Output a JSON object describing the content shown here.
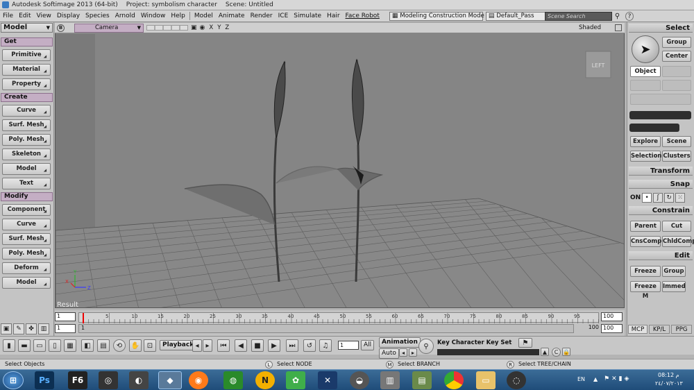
{
  "window": {
    "title_app": "Autodesk Softimage 2013 (64-bit)",
    "title_project": "Project: symbolism character",
    "title_scene": "Scene: Untitled"
  },
  "menus": [
    "File",
    "Edit",
    "View",
    "Display",
    "Species",
    "Arnold",
    "Window",
    "Help",
    "Model",
    "Animate",
    "Render",
    "ICE",
    "Simulate",
    "Hair",
    "Face Robot"
  ],
  "mode_dropdown": "Modeling Construction Mode",
  "pass_dropdown": "Default_Pass",
  "search_placeholder": "Scene Search",
  "left_panel": {
    "top_menu": "Model",
    "sections": [
      {
        "title": "Get",
        "buttons": [
          "Primitive",
          "Material",
          "Property"
        ]
      },
      {
        "title": "Create",
        "buttons": [
          "Curve",
          "Surf. Mesh",
          "Poly. Mesh",
          "Skeleton",
          "Model",
          "Text"
        ]
      },
      {
        "title": "Modify",
        "buttons": [
          "Component",
          "Curve",
          "Surf. Mesh",
          "Poly. Mesh",
          "Deform",
          "Model"
        ]
      }
    ]
  },
  "viewport": {
    "letter": "B",
    "camera": "Camera",
    "axes": [
      "X",
      "Y",
      "Z"
    ],
    "shading": "Shaded",
    "view_cube": "LEFT",
    "result": "Result",
    "gizmo": {
      "x": "X",
      "y": "Y",
      "z": "Z"
    }
  },
  "timeline": {
    "ticks": [
      "5",
      "10",
      "15",
      "20",
      "25",
      "30",
      "35",
      "40",
      "45",
      "50",
      "55",
      "60",
      "65",
      "70",
      "75",
      "80",
      "85",
      "90",
      "95"
    ],
    "start": "1",
    "end": "100",
    "range_start": "1",
    "range_end": "100",
    "range_end2": "100",
    "current": "1"
  },
  "right_panel": {
    "select_title": "Select",
    "group": "Group",
    "center": "Center",
    "object": "Object",
    "explore": "Explore",
    "scene": "Scene",
    "selection": "Selection",
    "clusters": "Clusters",
    "transform": "Transform",
    "snap": "Snap",
    "snap_on": "ON",
    "constrain": "Constrain",
    "parent": "Parent",
    "cut": "Cut",
    "cnscomp": "CnsComp",
    "chldcomp": "ChldComp",
    "edit": "Edit",
    "freeze": "Freeze",
    "group2": "Group",
    "freeze_m": "Freeze M",
    "immed": "Immed",
    "tabs": [
      "MCP",
      "KP/L",
      "PPG"
    ]
  },
  "playback": {
    "playback_label": "Playback",
    "frame": "1",
    "all": "All",
    "animation": "Animation",
    "auto": "Auto",
    "keyset": "Key Character Key Set"
  },
  "status": {
    "left": "Select Objects",
    "l_label": "L",
    "l_text": "Select NODE",
    "m_label": "M",
    "m_text": "Select BRANCH",
    "r_label": "R",
    "r_text": "Select TREE/CHAIN"
  },
  "taskbar": {
    "lang": "EN",
    "time": "08:12 م",
    "date": "٢٤/٠٧/٢٠١٣"
  },
  "colors": {
    "viewport_bg": "#858585",
    "section_header": "#c4aec4",
    "taskbar": "#2a5a88"
  }
}
